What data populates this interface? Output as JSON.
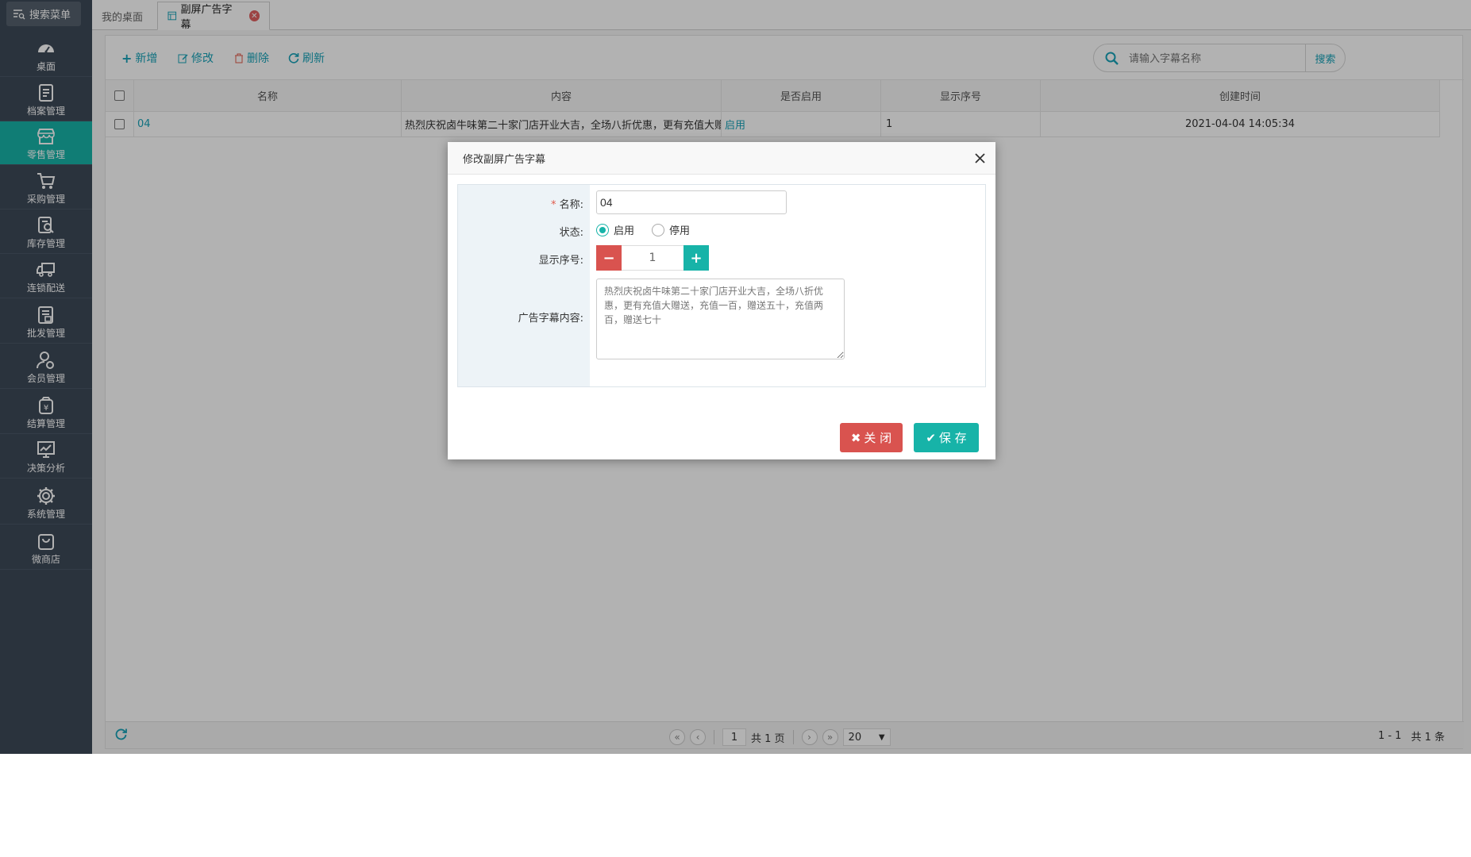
{
  "sidebar": {
    "search_label": "搜索菜单",
    "items": [
      {
        "label": "桌面",
        "icon": "dashboard-icon"
      },
      {
        "label": "档案管理",
        "icon": "archive-icon"
      },
      {
        "label": "零售管理",
        "icon": "store-icon",
        "active": true
      },
      {
        "label": "采购管理",
        "icon": "cart-icon"
      },
      {
        "label": "库存管理",
        "icon": "inventory-icon"
      },
      {
        "label": "连锁配送",
        "icon": "truck-icon"
      },
      {
        "label": "批发管理",
        "icon": "wholesale-icon"
      },
      {
        "label": "会员管理",
        "icon": "member-icon"
      },
      {
        "label": "结算管理",
        "icon": "settlement-icon"
      },
      {
        "label": "决策分析",
        "icon": "chart-icon"
      },
      {
        "label": "系统管理",
        "icon": "gear-icon"
      },
      {
        "label": "微商店",
        "icon": "shop-bag-icon"
      }
    ]
  },
  "tabs": {
    "home": "我的桌面",
    "active": "副屏广告字幕"
  },
  "toolbar": {
    "add": "新增",
    "edit": "修改",
    "delete": "删除",
    "refresh": "刷新",
    "search_placeholder": "请输入字幕名称",
    "search_button": "搜索"
  },
  "table": {
    "headers": [
      "名称",
      "内容",
      "是否启用",
      "显示序号",
      "创建时间"
    ],
    "rows": [
      {
        "name": "04",
        "content": "热烈庆祝卤牛味第二十家门店开业大吉，全场八折优惠，更有充值大赠",
        "enabled": "启用",
        "order": "1",
        "created": "2021-04-04 14:05:34"
      }
    ]
  },
  "pager": {
    "page": "1",
    "total_pages": "共 1 页",
    "page_size": "20",
    "range": "1 - 1",
    "total": "共 1 条"
  },
  "dialog": {
    "title": "修改副屏广告字幕",
    "name_label": "名称:",
    "name_required": "*",
    "name_value": "04",
    "status_label": "状态:",
    "status_on": "启用",
    "status_off": "停用",
    "status_selected": "启用",
    "order_label": "显示序号:",
    "order_value": "1",
    "content_label": "广告字幕内容:",
    "content_value": "热烈庆祝卤牛味第二十家门店开业大吉，全场八折优惠，更有充值大赠送，充值一百，赠送五十，充值两百，赠送七十",
    "close_button": "关 闭",
    "save_button": "保 存"
  },
  "colors": {
    "sidebar_bg": "#3d4a58",
    "accent": "#17b3a8",
    "danger": "#d9534f",
    "link": "#17a2b8"
  }
}
